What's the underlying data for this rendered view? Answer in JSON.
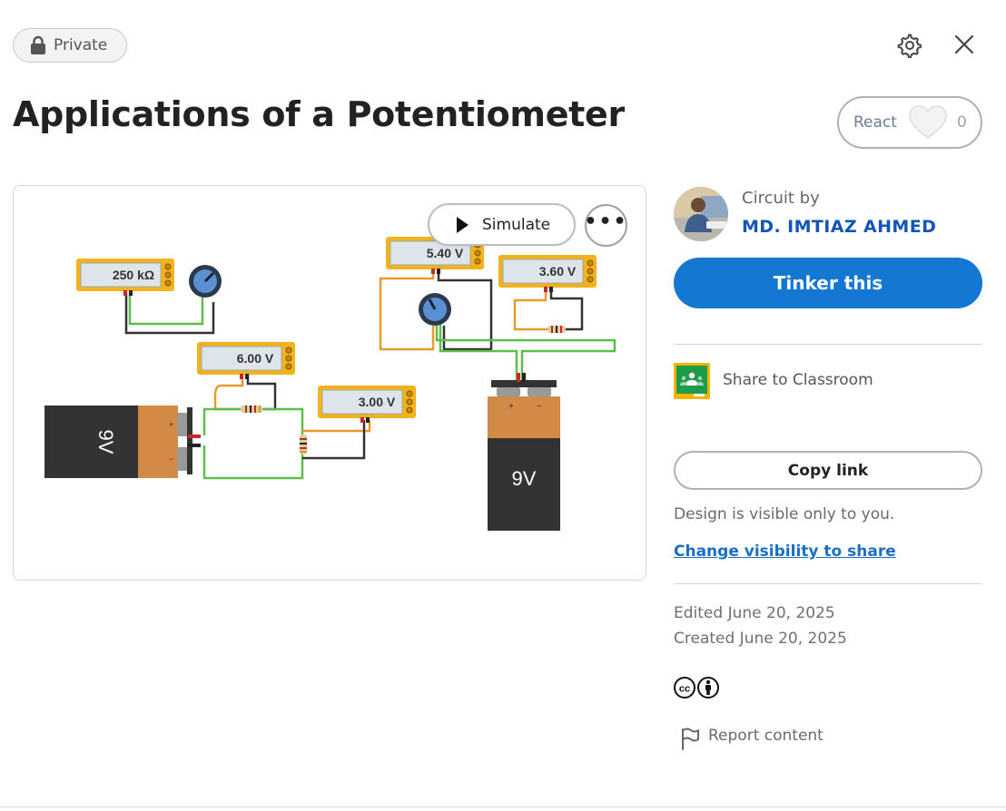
{
  "header": {
    "privacy_label": "Private",
    "title": "Applications of a Potentiometer"
  },
  "icons": {
    "lock": "lock-icon",
    "settings": "gear-icon",
    "close": "close-icon",
    "heart": "heart-icon",
    "play": "play-icon",
    "more": "more-icon",
    "classroom": "google-classroom-icon",
    "license": "creative-commons-by-icon",
    "report": "flag-icon"
  },
  "react": {
    "label": "React",
    "count": "0"
  },
  "canvas": {
    "simulate_label": "Simulate",
    "more_label": "•••",
    "meters": [
      {
        "reading": "250 kΩ"
      },
      {
        "reading": "6.00 V"
      },
      {
        "reading": "3.00 V"
      },
      {
        "reading": "5.40 V"
      },
      {
        "reading": "3.60 V"
      }
    ],
    "batteries": [
      {
        "label": "9V"
      },
      {
        "label": "9V"
      }
    ]
  },
  "sidebar": {
    "circuit_by_label": "Circuit by",
    "author": "MD. IMTIAZ AHMED",
    "tinker_label": "Tinker this",
    "share_classroom_label": "Share to Classroom",
    "copy_link_label": "Copy link",
    "visibility_note": "Design is visible only to you.",
    "visibility_link": "Change visibility to share",
    "edited": "Edited June 20, 2025",
    "created": "Created June 20, 2025",
    "report_label": "Report content"
  },
  "colors": {
    "primary_button": "#1477d2",
    "author_link": "#1456b8",
    "meter_body": "#f2b21b",
    "battery_terminal": "#d38a47",
    "battery_body": "#333333",
    "wire_green": "#5bbf4a",
    "wire_orange": "#e89a2c",
    "wire_black": "#333333",
    "classroom_green": "#1f9c4a",
    "classroom_yellow": "#f5b400"
  }
}
